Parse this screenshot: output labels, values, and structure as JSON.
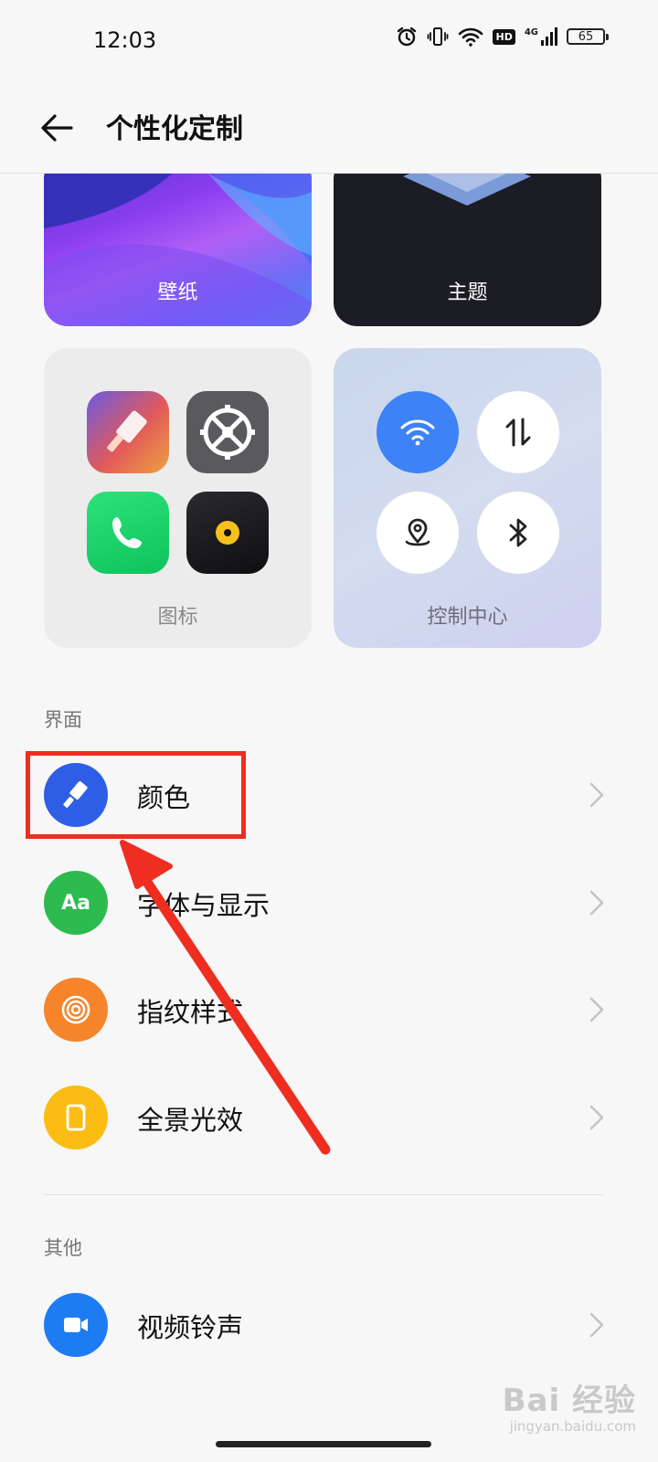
{
  "status_bar": {
    "time": "12:03",
    "network": "4G",
    "hd_badge": "HD",
    "battery": "65"
  },
  "header": {
    "title": "个性化定制"
  },
  "cards": {
    "wallpaper": "壁纸",
    "theme": "主题",
    "icons": "图标",
    "control_center": "控制中心"
  },
  "sections": {
    "interface": {
      "label": "界面",
      "items": [
        {
          "label": "颜色",
          "icon": "paint-brush-icon",
          "color": "#2f5ee6"
        },
        {
          "label": "字体与显示",
          "icon_text": "Aa",
          "color": "#2dbb4f"
        },
        {
          "label": "指纹样式",
          "icon": "fingerprint-icon",
          "color": "#f5842a"
        },
        {
          "label": "全景光效",
          "icon": "edge-light-icon",
          "color": "#fbbd14"
        }
      ]
    },
    "other": {
      "label": "其他",
      "items": [
        {
          "label": "视频铃声",
          "icon": "video-camera-icon",
          "color": "#1e7cf2"
        }
      ]
    }
  },
  "watermark": {
    "main": "Bai 经验",
    "sub": "jingyan.baidu.com"
  },
  "colors": {
    "highlight": "#ef2d20",
    "wifi_active": "#3d82f6"
  }
}
